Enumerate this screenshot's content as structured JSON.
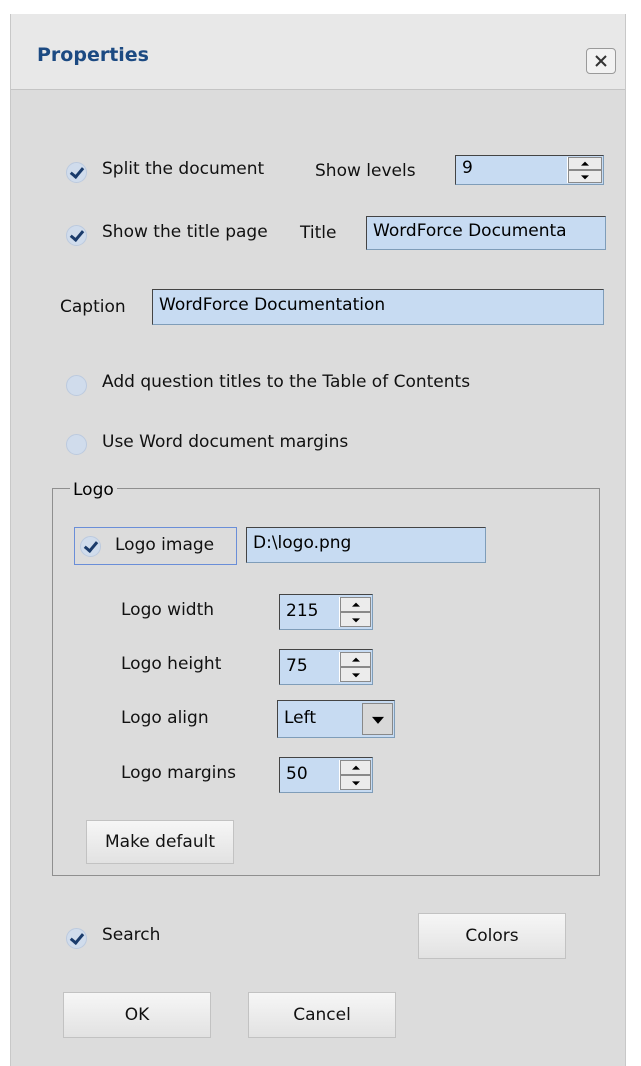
{
  "dialog": {
    "title": "Properties"
  },
  "split": {
    "label": "Split the document",
    "checked": true
  },
  "show_levels": {
    "label": "Show levels",
    "value": "9"
  },
  "title_page": {
    "label": "Show the title page",
    "checked": true
  },
  "title_field": {
    "label": "Title",
    "value": "WordForce Documenta"
  },
  "caption": {
    "label": "Caption",
    "value": "WordForce Documentation"
  },
  "add_question_titles": {
    "label": "Add question titles to the Table of Contents",
    "checked": false
  },
  "word_margins": {
    "label": "Use Word document margins",
    "checked": false
  },
  "logo": {
    "group_label": "Logo",
    "image_label": "Logo image",
    "image_checked": true,
    "image_path": "D:\\logo.png",
    "width_label": "Logo width",
    "width_value": "215",
    "height_label": "Logo height",
    "height_value": "75",
    "align_label": "Logo align",
    "align_value": "Left",
    "margins_label": "Logo margins",
    "margins_value": "50",
    "make_default_label": "Make default"
  },
  "search": {
    "label": "Search",
    "checked": true
  },
  "buttons": {
    "colors": "Colors",
    "ok": "OK",
    "cancel": "Cancel"
  },
  "icons": {
    "close": "close-icon",
    "check": "checkmark-icon",
    "spin_up": "arrow-up-icon",
    "spin_down": "arrow-down-icon",
    "dropdown": "chevron-down-icon"
  }
}
